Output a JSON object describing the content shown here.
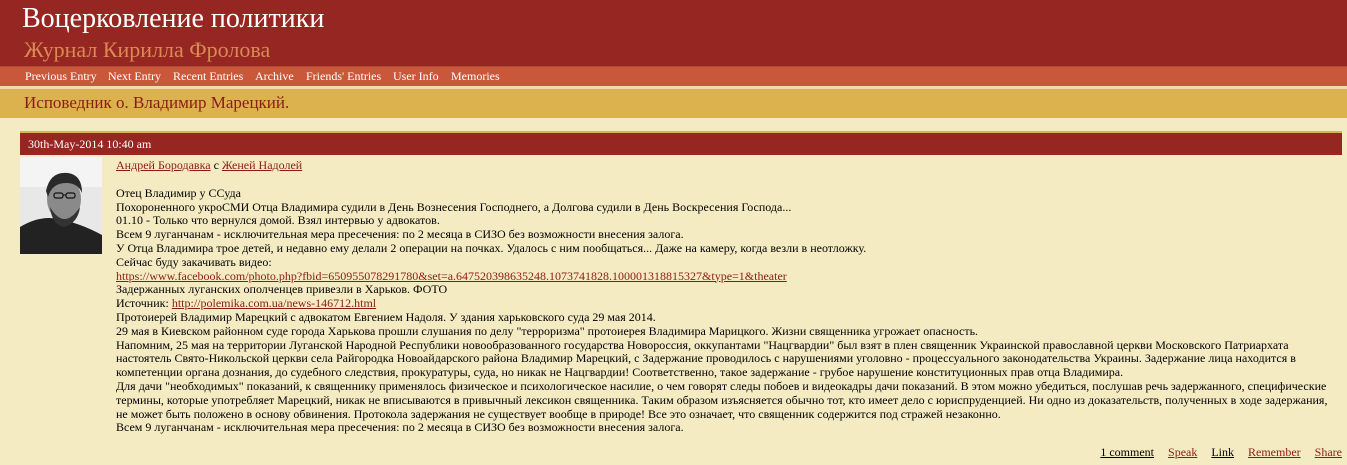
{
  "header": {
    "title": "Воцерковление политики",
    "subtitle": "Журнал Кирилла Фролова"
  },
  "nav": {
    "items": [
      "Previous Entry",
      "Next Entry",
      "Recent Entries",
      "Archive",
      "Friends' Entries",
      "User Info",
      "Memories"
    ]
  },
  "entry": {
    "title": "Исповедник о. Владимир Марецкий.",
    "date": "30th-May-2014 10:40 am",
    "author": "Андрей Бородавка",
    "with_word": "с",
    "coauthor": "Женей Надолей",
    "lines": {
      "l1": "Отец Владимир у ССуда",
      "l2": "Похороненного укроСМИ Отца Владимира судили в День Вознесения Господнего, а Долгова судили в День Воскресения Господа...",
      "l3": "01.10 - Только что вернулся домой. Взял интервью у адвокатов.",
      "l4": "Всем 9 луганчанам - исключительная мера пресечения: по 2 месяца в СИЗО без возможности внесения залога.",
      "l5": "У Отца Владимира трое детей, и недавно ему делали 2 операции на почках. Удалось с ним пообщаться... Даже на камеру, когда везли в неотложку.",
      "l6": "Сейчас буду закачивать видео:",
      "link1": "https://www.facebook.com/photo.php?fbid=650955078291780&set=a.647520398635248.1073741828.100001318815327&type=1&theater",
      "l7": "Задержанных луганских ополченцев привезли в Харьков. ФОТО",
      "source_label": "Источник:",
      "link2": "http://polemika.com.ua/news-146712.html",
      "l8": "Протоиерей Владимир Марецкий с адвокатом Евгением Надоля. У здания харьковского суда 29 мая 2014.",
      "l9": "29 мая в Киевском районном суде города Харькова прошли слушания по делу \"терроризма\" протоиерея Владимира Марицкого. Жизни священника угрожает опасность.",
      "p1": "Напомним, 25 мая на территории Луганской Народной Республики новообразованного государства Новороссия, оккупантами \"Нацгвардии\" был взят в плен священник Украинской православной церкви Московского Патриархата настоятель Свято-Никольской церкви села Райгородка Новоайдарского района Владимир Марецкий, с Задержание проводилось с нарушениями уголовно - процессуального законодательства Украины. Задержание лица находится в компетенции органа дознания, до судебного следствия, прокуратуры, суда, но никак не Нацгвардии! Соответственно, такое задержание - грубое нарушение конституционных прав отца Владимира.",
      "p2": "Для дачи \"необходимых\" показаний, к священнику применялось физическое и психологическое насилие, о чем говорят следы побоев и видеокадры дачи показаний. В этом можно убедиться, послушав речь задержанного, специфические термины, которые употребляет Марецкий, никак не вписываются в привычный лексикон священника. Таким образом изъясняется обычно тот, кто имеет дело с юриспруденцией. Ни одно из доказательств, полученных в ходе задержания, не может быть положено в основу обвинения. Протокола задержания не существует вообще в природе! Все это означает, что священник содержится под стражей незаконно.",
      "l10": "Всем 9 луганчанам - исключительная мера пресечения: по 2 месяца в СИЗО без возможности внесения залога."
    }
  },
  "footer_links": {
    "comments": "1 comment",
    "speak": "Speak",
    "link": "Link",
    "remember": "Remember",
    "share": "Share"
  },
  "colors": {
    "header_bg": "#962622",
    "nav_bg": "#c9583b",
    "title_bar_bg": "#dcb24e",
    "page_bg": "#f5ebc3",
    "link": "#8a1c17"
  },
  "icons": {
    "avatar": "user-photo-avatar"
  }
}
